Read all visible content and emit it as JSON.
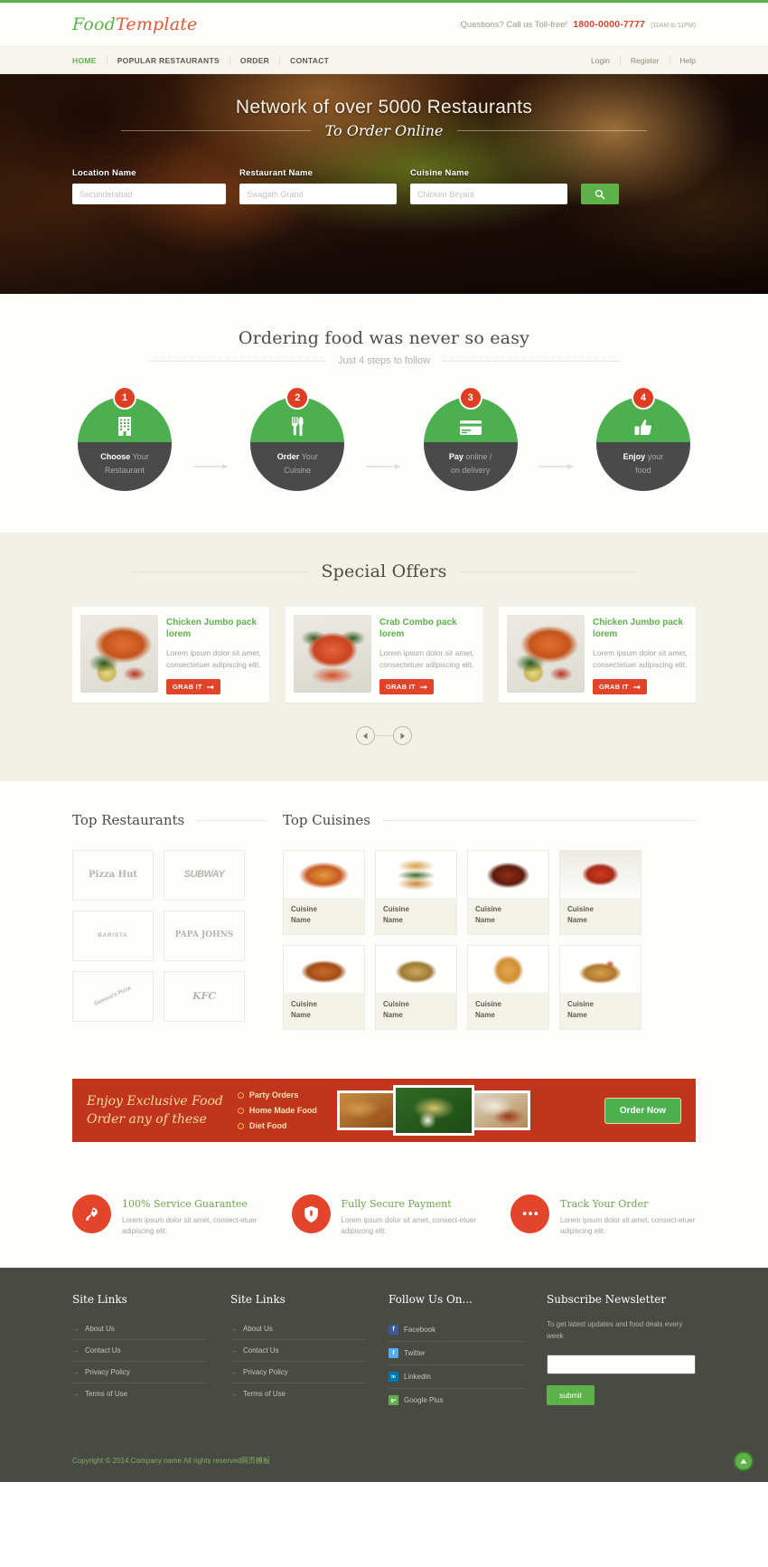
{
  "header": {
    "logo_first": "Food",
    "logo_second": "Template",
    "call_text": "Questions? Call us Toll-free!",
    "phone": "1800-0000-7777",
    "hours": "(11AM to 11PM)"
  },
  "nav": {
    "main": [
      {
        "label": "HOME",
        "active": true
      },
      {
        "label": "POPULAR RESTAURANTS",
        "active": false
      },
      {
        "label": "ORDER",
        "active": false
      },
      {
        "label": "CONTACT",
        "active": false
      }
    ],
    "user": [
      {
        "label": "Login"
      },
      {
        "label": "Register"
      },
      {
        "label": "Help"
      }
    ]
  },
  "hero": {
    "title": "Network of over 5000 Restaurants",
    "subtitle": "To Order Online",
    "search": {
      "location_label": "Location Name",
      "location_placeholder": "Secunderabad",
      "restaurant_label": "Restaurant Name",
      "restaurant_placeholder": "Swagath Grand",
      "cuisine_label": "Cuisine Name",
      "cuisine_placeholder": "Chicken Biryani",
      "button_icon": "search-icon"
    }
  },
  "steps_section": {
    "title": "Ordering food was never so easy",
    "subtitle": "Just 4 steps to follow",
    "steps": [
      {
        "number": "1",
        "icon": "building-icon",
        "bold": "Choose",
        "rest": " Your",
        "line2": "Restaurant"
      },
      {
        "number": "2",
        "icon": "cutlery-icon",
        "bold": "Order",
        "rest": " Your",
        "line2": "Cuisine"
      },
      {
        "number": "3",
        "icon": "credit-card-icon",
        "bold": "Pay",
        "rest": " online /",
        "line2": "on delivery"
      },
      {
        "number": "4",
        "icon": "thumbs-up-icon",
        "bold": "Enjoy",
        "rest": " your",
        "line2": "food"
      }
    ]
  },
  "offers_section": {
    "title": "Special Offers",
    "offers": [
      {
        "title": "Chicken Jumbo pack lorem",
        "desc": "Lorem ipsum dolor sit amet, consectetuer adipiscing elit.",
        "button": "GRAB IT",
        "img": "chicken"
      },
      {
        "title": "Crab Combo pack lorem",
        "desc": "Lorem ipsum dolor sit amet, consectetuer adipiscing elit.",
        "button": "GRAB IT",
        "img": "crab"
      },
      {
        "title": "Chicken Jumbo pack lorem",
        "desc": "Lorem ipsum dolor sit amet, consectetuer adipiscing elit.",
        "button": "GRAB IT",
        "img": "chicken"
      }
    ],
    "prev_icon": "chevron-left-icon",
    "next_icon": "chevron-right-icon"
  },
  "tops_section": {
    "restaurants_title": "Top Restaurants",
    "cuisines_title": "Top Cuisines",
    "restaurants": [
      {
        "name": "Pizza Hut",
        "cls": "lg-pizzahut"
      },
      {
        "name": "SUBWAY",
        "cls": "lg-subway"
      },
      {
        "name": "BARISTA",
        "cls": "lg-barista"
      },
      {
        "name": "PAPA JOHNS",
        "cls": "lg-papa"
      },
      {
        "name": "Domino's Pizza",
        "cls": "lg-dominos"
      },
      {
        "name": "KFC",
        "cls": "lg-kfc"
      }
    ],
    "cuisines": [
      {
        "line1": "Cuisine",
        "line2": "Name",
        "img": "ci-pizza"
      },
      {
        "line1": "Cuisine",
        "line2": "Name",
        "img": "ci-burger"
      },
      {
        "line1": "Cuisine",
        "line2": "Name",
        "img": "ci-curry"
      },
      {
        "line1": "Cuisine",
        "line2": "Name",
        "img": "ci-tomato"
      },
      {
        "line1": "Cuisine",
        "line2": "Name",
        "img": "ci-wings"
      },
      {
        "line1": "Cuisine",
        "line2": "Name",
        "img": "ci-rice"
      },
      {
        "line1": "Cuisine",
        "line2": "Name",
        "img": "ci-noodle"
      },
      {
        "line1": "Cuisine",
        "line2": "Name",
        "img": "ci-pasta"
      }
    ]
  },
  "banner": {
    "title_line1": "Enjoy Exclusive Food",
    "title_line2": "Order any of these",
    "items": [
      "Party Orders",
      "Home Made Food",
      "Diet Food"
    ],
    "button": "Order Now"
  },
  "features": [
    {
      "icon": "rocket-icon",
      "title": "100% Service Guarantee",
      "desc": "Lorem ipsum dolor sit amet, consect-etuer adipiscing elit."
    },
    {
      "icon": "shield-icon",
      "title": "Fully Secure Payment",
      "desc": "Lorem ipsum dolor sit amet, consect-etuer adipiscing elit."
    },
    {
      "icon": "dots-icon",
      "title": "Track Your Order",
      "desc": "Lorem ipsum dolor sit amet, consect-etuer adipiscing elit."
    }
  ],
  "footer": {
    "col1": {
      "title": "Site Links",
      "links": [
        "About Us",
        "Contact Us",
        "Privacy Policy",
        "Terms of Use"
      ]
    },
    "col2": {
      "title": "Site Links",
      "links": [
        "About Us",
        "Contact Us",
        "Privacy Policy",
        "Terms of Use"
      ]
    },
    "social": {
      "title": "Follow Us On...",
      "links": [
        {
          "label": "Facebook",
          "glyph": "f",
          "color": "#3b5998"
        },
        {
          "label": "Twitter",
          "glyph": "t",
          "color": "#55acee"
        },
        {
          "label": "Linkedin",
          "glyph": "in",
          "color": "#0077b5"
        },
        {
          "label": "Google Plus",
          "glyph": "g+",
          "color": "#5eb24a"
        }
      ]
    },
    "newsletter": {
      "title": "Subscribe Newsletter",
      "desc": "To get latest updates and food deals every week",
      "input_placeholder": "",
      "input_value": "",
      "button": "submit"
    },
    "copyright": "Copyright © 2014.Company name All rights reserved",
    "copyright_extra": "网页模板",
    "to_top_icon": "arrow-up-icon"
  },
  "colors": {
    "green": "#5eb24a",
    "red": "#e2442a",
    "dark_red": "#c0351c",
    "dark": "#4a4a45",
    "cream": "#f2f1e7"
  }
}
